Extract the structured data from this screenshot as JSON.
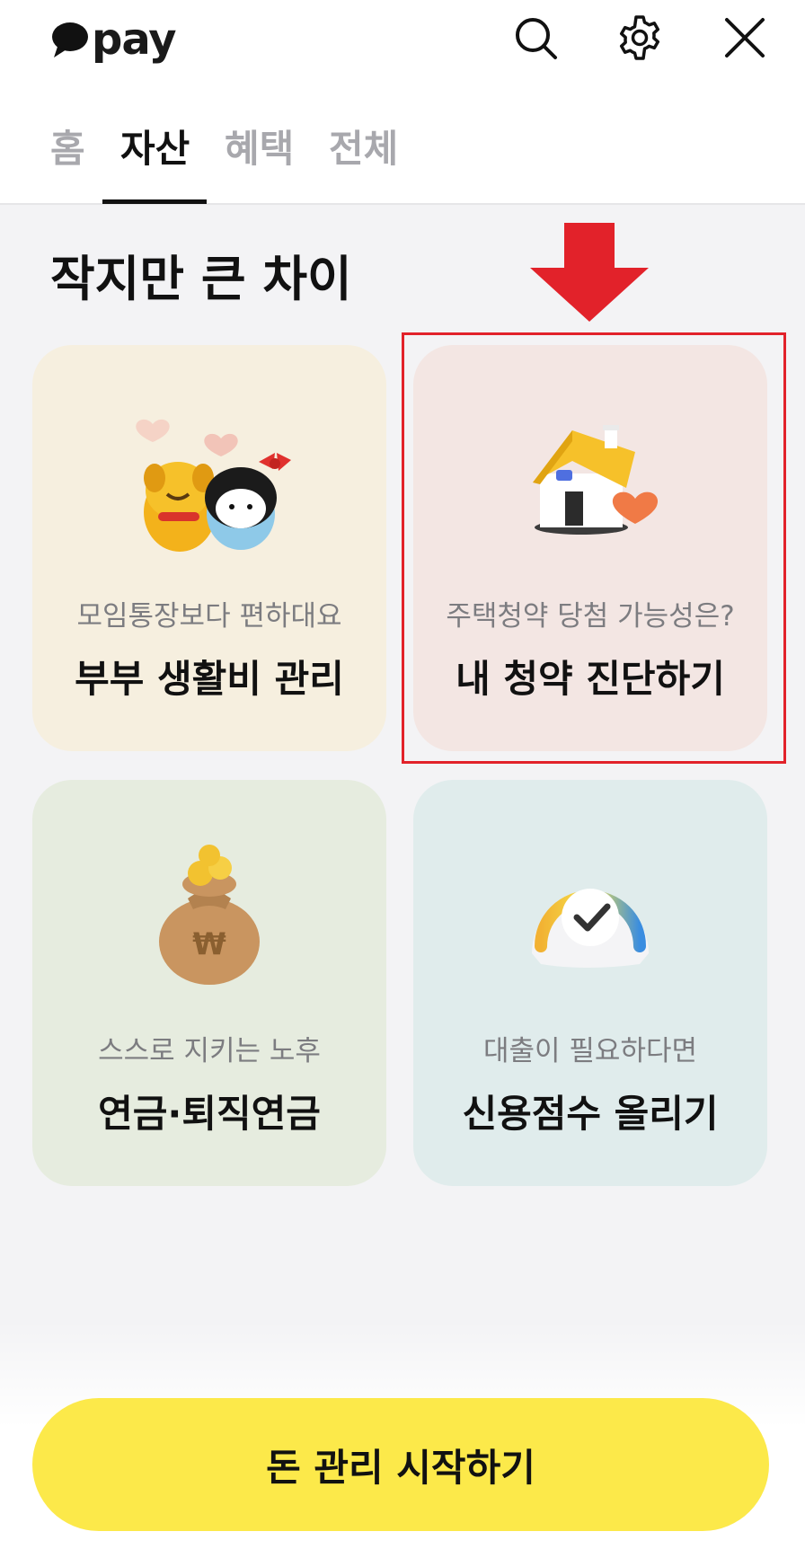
{
  "header": {
    "logo_text": "pay",
    "icons": [
      "search-icon",
      "gear-icon",
      "close-icon"
    ]
  },
  "tabs": [
    {
      "label": "홈",
      "active": false
    },
    {
      "label": "자산",
      "active": true
    },
    {
      "label": "혜택",
      "active": false
    },
    {
      "label": "전체",
      "active": false
    }
  ],
  "section": {
    "title": "작지만 큰 차이",
    "cards": [
      {
        "subtitle": "모임통장보다 편하대요",
        "title": "부부 생활비 관리",
        "icon": "couple-characters-icon"
      },
      {
        "subtitle": "주택청약 당첨 가능성은?",
        "title": "내 청약 진단하기",
        "icon": "house-icon"
      },
      {
        "subtitle": "스스로 지키는 노후",
        "title": "연금·퇴직연금",
        "icon": "money-bag-icon"
      },
      {
        "subtitle": "대출이 필요하다면",
        "title": "신용점수 올리기",
        "icon": "credit-gauge-icon"
      }
    ]
  },
  "cta": {
    "label": "돈 관리 시작하기"
  },
  "colors": {
    "accent_yellow": "#fce94a",
    "highlight_red": "#e2222a",
    "background": "#f3f3f5"
  }
}
